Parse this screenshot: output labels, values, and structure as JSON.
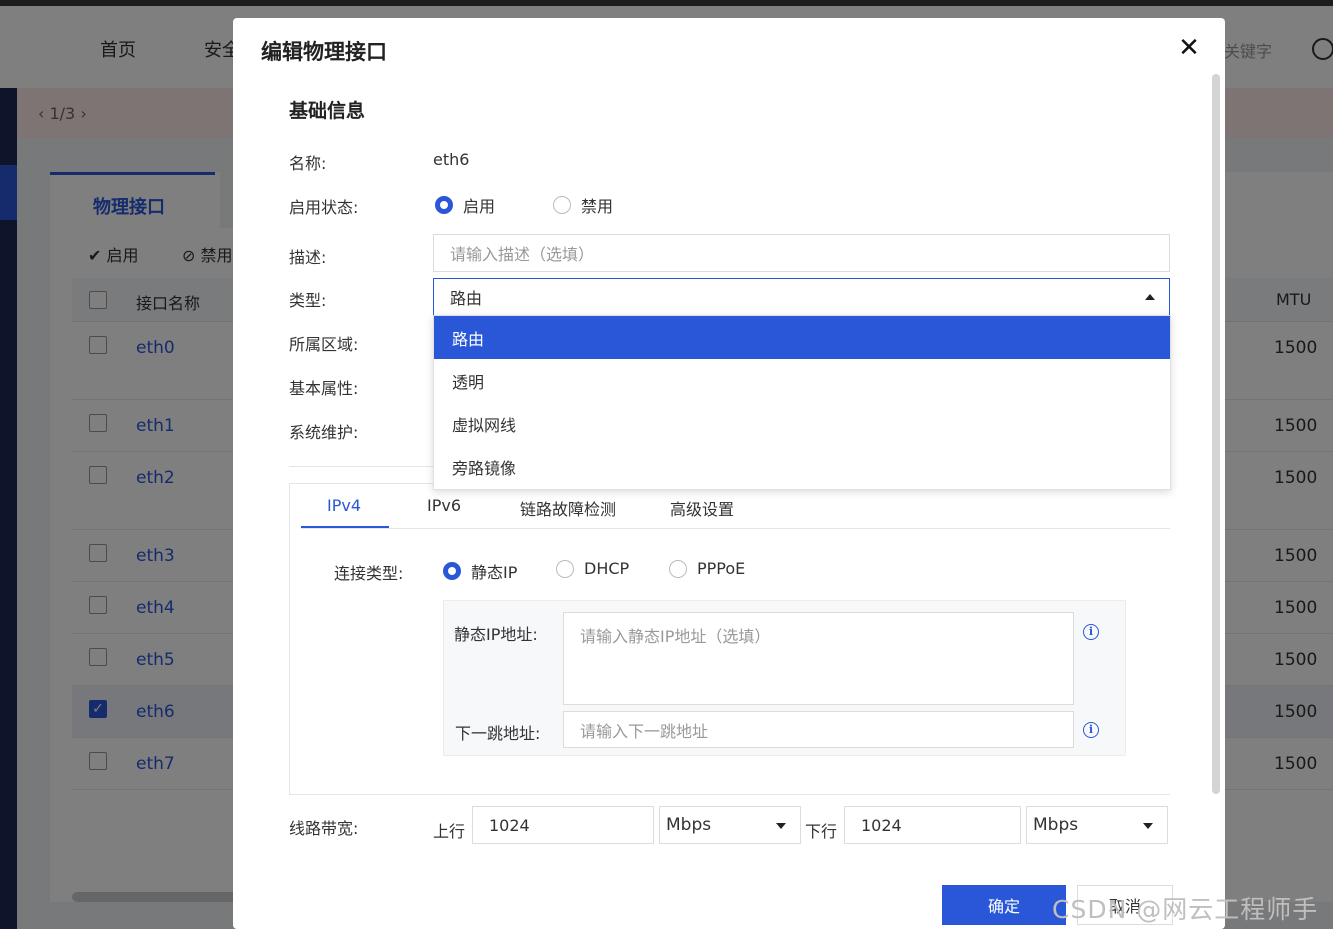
{
  "background": {
    "nav": [
      "首页",
      "安全"
    ],
    "search_placeholder": "关键字",
    "pager": "1/3",
    "tab_label": "物理接口",
    "tool_enable": "启用",
    "tool_disable": "禁用",
    "col_name": "接口名称",
    "col_mtu": "MTU",
    "rows": [
      {
        "name": "eth0",
        "mtu": "1500",
        "checked": false
      },
      {
        "name": "eth1",
        "mtu": "1500",
        "checked": false
      },
      {
        "name": "eth2",
        "mtu": "1500",
        "checked": false
      },
      {
        "name": "eth3",
        "mtu": "1500",
        "checked": false
      },
      {
        "name": "eth4",
        "mtu": "1500",
        "checked": false
      },
      {
        "name": "eth5",
        "mtu": "1500",
        "checked": false
      },
      {
        "name": "eth6",
        "mtu": "1500",
        "checked": true
      },
      {
        "name": "eth7",
        "mtu": "1500",
        "checked": false
      }
    ]
  },
  "modal": {
    "title": "编辑物理接口",
    "close": "✕",
    "section_basic": "基础信息",
    "name_label": "名称:",
    "name_value": "eth6",
    "status_label": "启用状态:",
    "status_enable": "启用",
    "status_disable": "禁用",
    "desc_label": "描述:",
    "desc_placeholder": "请输入描述（选填）",
    "type_label": "类型:",
    "type_value": "路由",
    "type_options": [
      "路由",
      "透明",
      "虚拟网线",
      "旁路镜像"
    ],
    "zone_label": "所属区域:",
    "basic_attr_label": "基本属性:",
    "sys_maint_label": "系统维护:",
    "tabs": [
      "IPv4",
      "IPv6",
      "链路故障检测",
      "高级设置"
    ],
    "conn_type_label": "连接类型:",
    "conn_static": "静态IP",
    "conn_dhcp": "DHCP",
    "conn_pppoe": "PPPoE",
    "static_ip_label": "静态IP地址:",
    "static_ip_placeholder": "请输入静态IP地址（选填）",
    "next_hop_label": "下一跳地址:",
    "next_hop_placeholder": "请输入下一跳地址",
    "bandwidth_label": "线路带宽:",
    "up_label": "上行",
    "up_value": "1024",
    "up_unit": "Mbps",
    "down_label": "下行",
    "down_value": "1024",
    "down_unit": "Mbps",
    "ok": "确定",
    "cancel": "取消"
  },
  "watermark": "CSDN @网云工程师手记",
  "colors": {
    "accent": "#2a57d8",
    "sidebar": "#1d2a55"
  }
}
